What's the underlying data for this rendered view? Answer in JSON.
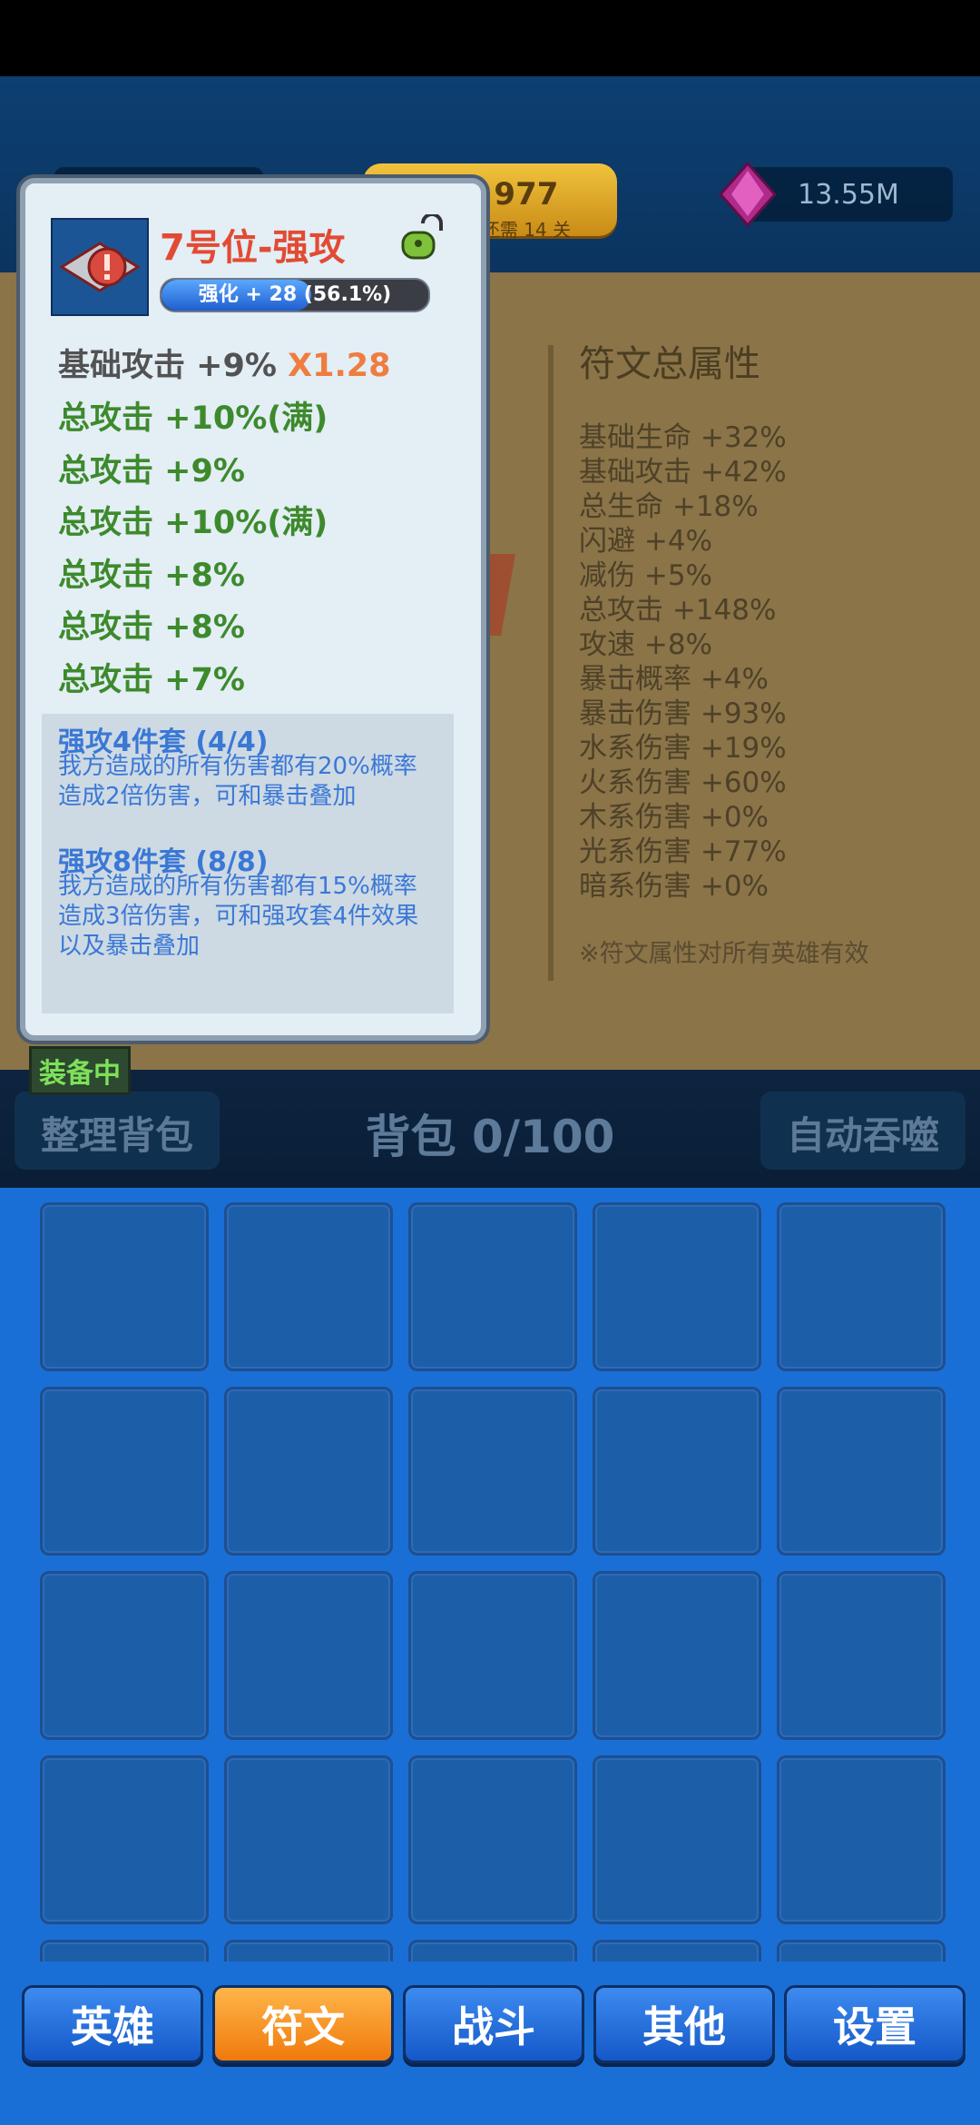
{
  "top_bar": {
    "stage_label": "关卡 977",
    "stage_sub": "解锁功能还需 14 关",
    "gems": "13.55M"
  },
  "rune_popup": {
    "name": "7号位-强攻",
    "progress_label": "强化 + 28  (56.1%)",
    "progress_fraction": 0.561,
    "base_stat": "基础攻击 +9%",
    "multiplier": "X1.28",
    "stats": [
      "总攻击 +10%(满)",
      "总攻击 +9%",
      "总攻击 +10%(满)",
      "总攻击 +8%",
      "总攻击 +8%",
      "总攻击 +7%"
    ],
    "sets": [
      {
        "title": "强攻4件套  (4/4)",
        "desc": "我方造成的所有伤害都有20%概率造成2倍伤害，可和暴击叠加"
      },
      {
        "title": "强攻8件套  (8/8)",
        "desc": "我方造成的所有伤害都有15%概率造成3倍伤害，可和强攻套4件效果以及暴击叠加"
      }
    ],
    "equipped_tag": "装备中"
  },
  "rune_attributes": {
    "title": "符文总属性",
    "lines": [
      "基础生命 +32%",
      "基础攻击 +42%",
      "总生命 +18%",
      "闪避 +4%",
      "减伤 +5%",
      "总攻击 +148%",
      "攻速 +8%",
      "暴击概率 +4%",
      "暴击伤害 +93%",
      "水系伤害 +19%",
      "火系伤害 +60%",
      "木系伤害 +0%",
      "光系伤害 +77%",
      "暗系伤害 +0%"
    ],
    "note": "※符文属性对所有英雄有效"
  },
  "bag": {
    "sort_label": "整理背包",
    "count_label": "背包 0/100",
    "devour_label": "自动吞噬"
  },
  "nav": {
    "tabs": [
      {
        "label": "英雄",
        "active": false
      },
      {
        "label": "符文",
        "active": true
      },
      {
        "label": "战斗",
        "active": false
      },
      {
        "label": "其他",
        "active": false
      },
      {
        "label": "设置",
        "active": false
      }
    ]
  },
  "colors": {
    "accent_orange": "#f07a0c",
    "nav_blue": "#1458c8",
    "rune_name_red": "#e24b33",
    "stat_green": "#3d8a2c"
  }
}
